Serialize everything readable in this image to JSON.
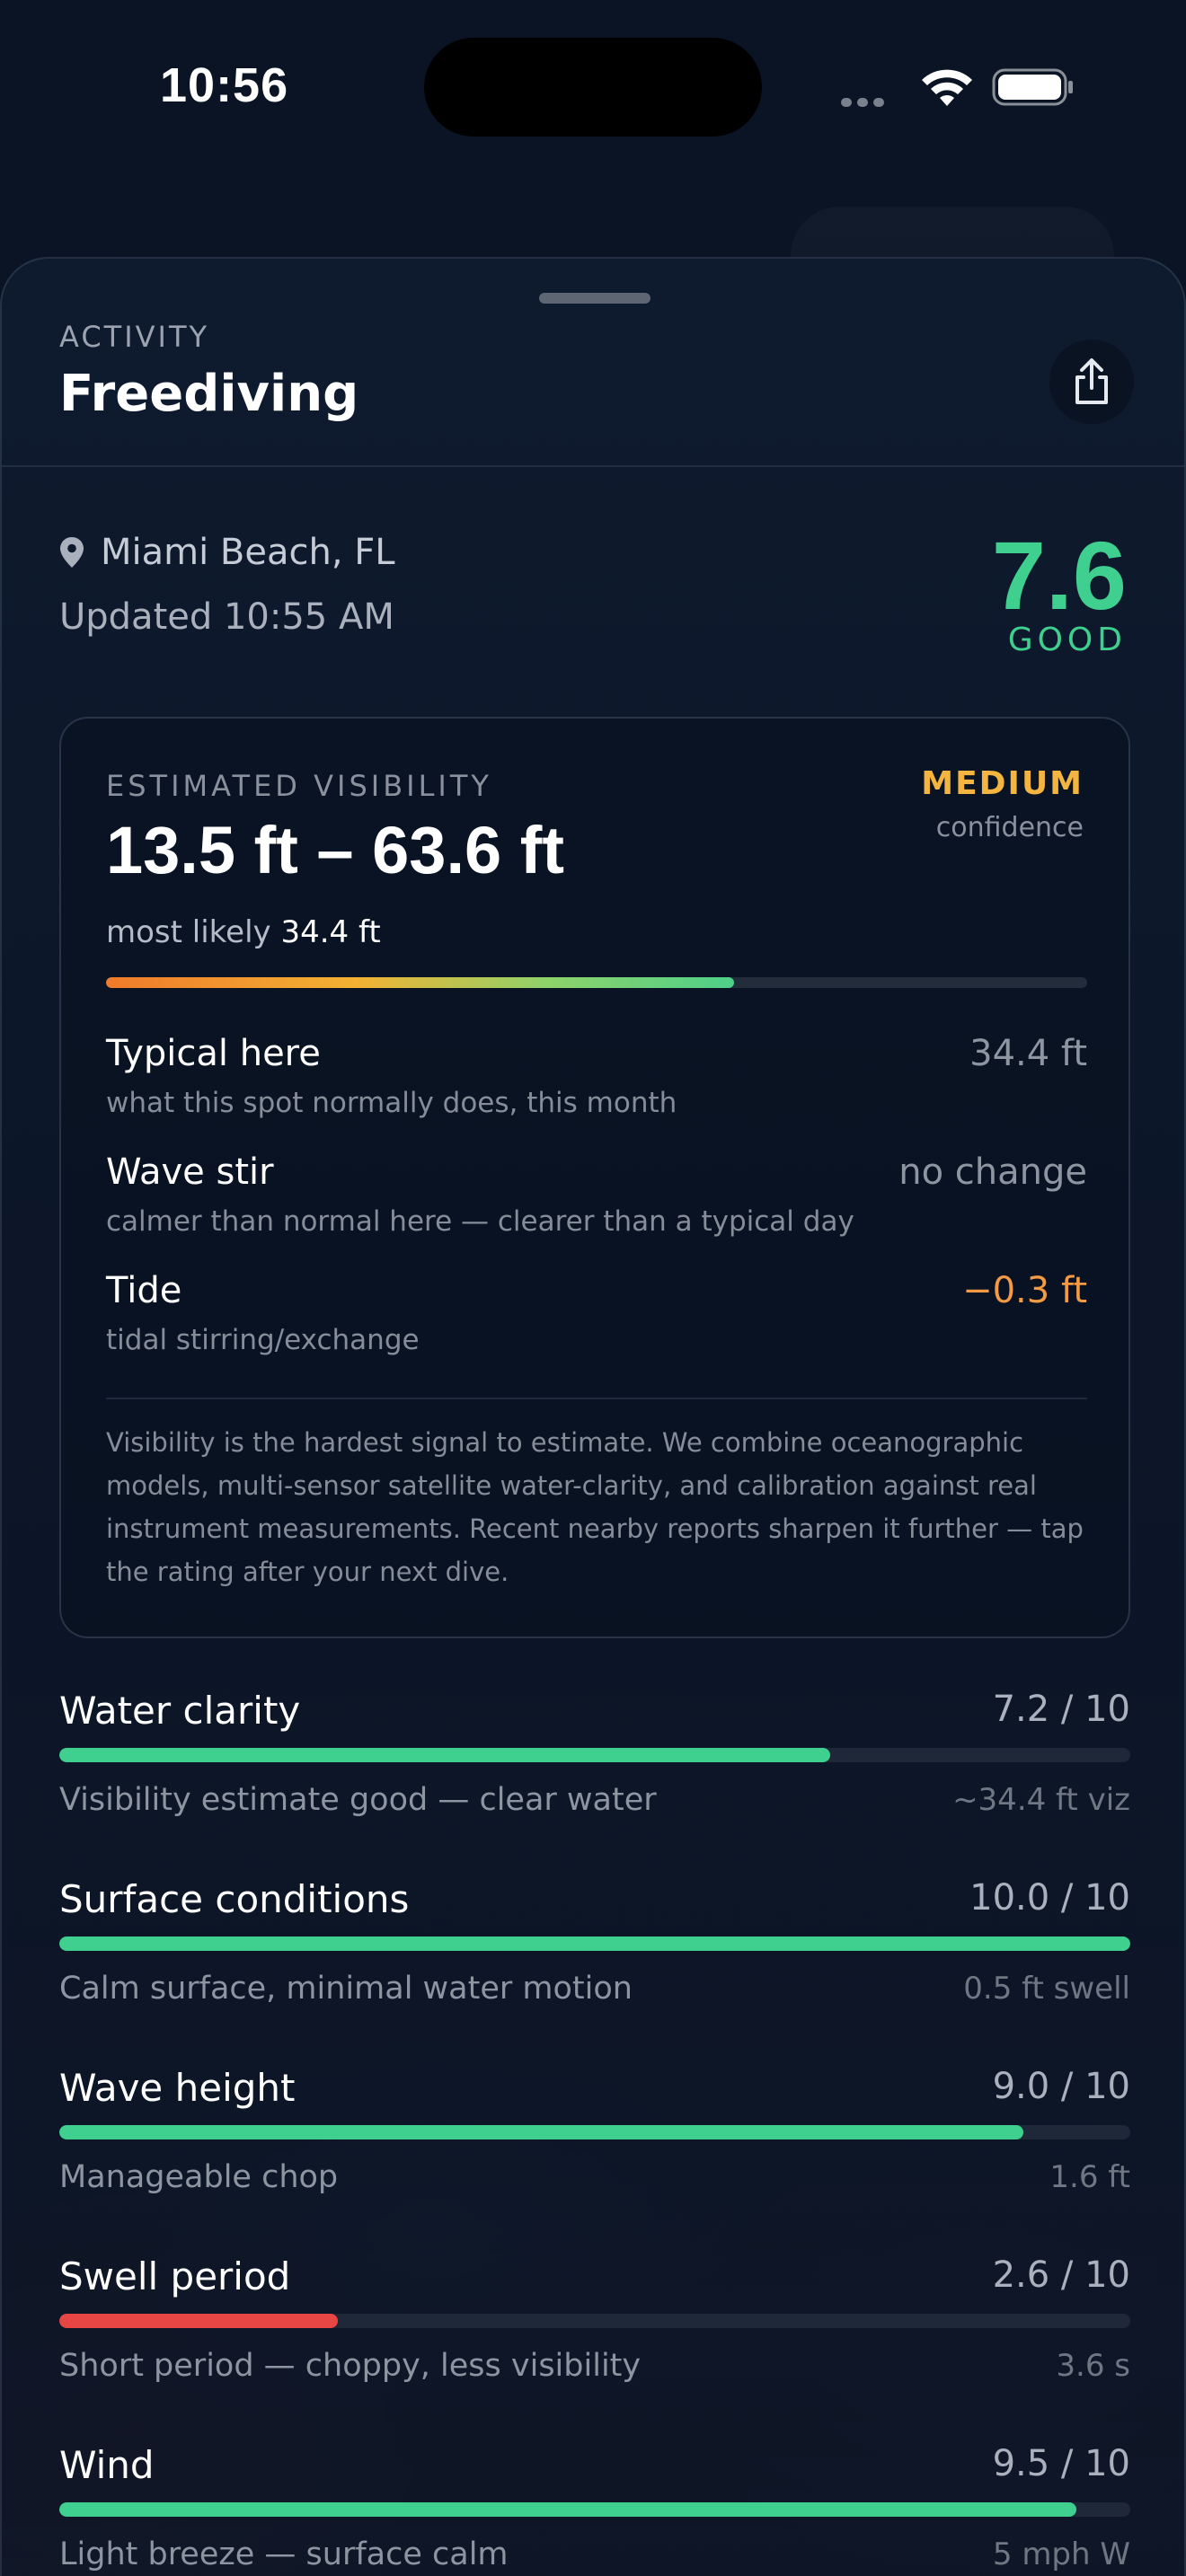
{
  "status_bar": {
    "time": "10:56"
  },
  "sheet": {
    "eyebrow": "ACTIVITY",
    "title": "Freediving"
  },
  "location": {
    "name": "Miami Beach, FL",
    "updated": "Updated 10:55 AM"
  },
  "overall": {
    "score": "7.6",
    "label": "GOOD"
  },
  "visibility": {
    "eyebrow": "ESTIMATED VISIBILITY",
    "confidence": "MEDIUM",
    "confidence_sub": "confidence",
    "range": "13.5 ft – 63.6 ft",
    "likely_prefix": "most likely",
    "likely_value": "34.4 ft",
    "bar_fraction": 0.64,
    "factors": [
      {
        "label": "Typical here",
        "sub": "what this spot normally does, this month",
        "value": "34.4 ft",
        "value_color": "#8d95a1"
      },
      {
        "label": "Wave stir",
        "sub": "calmer than normal here — clearer than a typical day",
        "value": "no change",
        "value_color": "#8d95a1"
      },
      {
        "label": "Tide",
        "sub": "tidal stirring/exchange",
        "value": "−0.3 ft",
        "value_color": "#f39a45"
      }
    ],
    "note": "Visibility is the hardest signal to estimate. We combine oceanographic models, multi-sensor satellite water-clarity, and calibration against real instrument measurements. Recent nearby reports sharpen it further — tap the rating after your next dive."
  },
  "metrics": [
    {
      "label": "Water clarity",
      "score": "7.2 / 10",
      "fraction": 0.72,
      "color": "#3fcf8e",
      "desc": "Visibility estimate good — clear water",
      "right": "~34.4 ft viz"
    },
    {
      "label": "Surface conditions",
      "score": "10.0 / 10",
      "fraction": 1.0,
      "color": "#3fcf8e",
      "desc": "Calm surface, minimal water motion",
      "right": "0.5 ft swell"
    },
    {
      "label": "Wave height",
      "score": "9.0 / 10",
      "fraction": 0.9,
      "color": "#3fcf8e",
      "desc": "Manageable chop",
      "right": "1.6 ft"
    },
    {
      "label": "Swell period",
      "score": "2.6 / 10",
      "fraction": 0.26,
      "color": "#e84545",
      "desc": "Short period — choppy, less visibility",
      "right": "3.6 s"
    },
    {
      "label": "Wind",
      "score": "9.5 / 10",
      "fraction": 0.95,
      "color": "#3fcf8e",
      "desc": "Light breeze — surface calm",
      "right": "5 mph W"
    }
  ]
}
